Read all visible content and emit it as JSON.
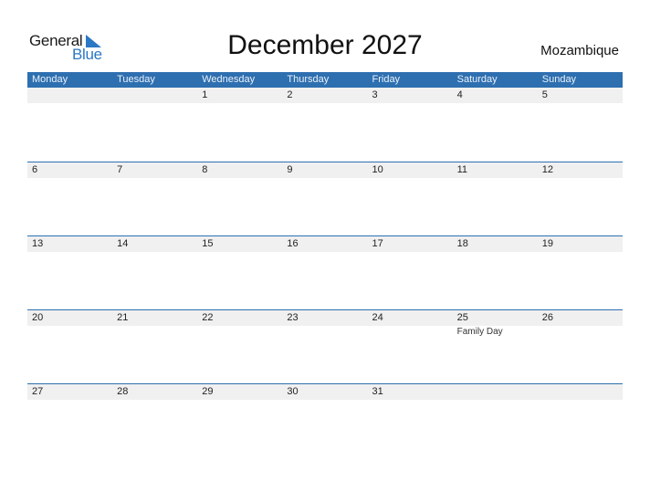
{
  "logo": {
    "general": "General",
    "blue": "Blue",
    "accent": "#2b78c5"
  },
  "title": "December 2027",
  "country": "Mozambique",
  "header_color": "#2e6fb0",
  "weekdays": [
    "Monday",
    "Tuesday",
    "Wednesday",
    "Thursday",
    "Friday",
    "Saturday",
    "Sunday"
  ],
  "weeks": [
    {
      "days": [
        "",
        "",
        "1",
        "2",
        "3",
        "4",
        "5"
      ],
      "events": [
        "",
        "",
        "",
        "",
        "",
        "",
        ""
      ]
    },
    {
      "days": [
        "6",
        "7",
        "8",
        "9",
        "10",
        "11",
        "12"
      ],
      "events": [
        "",
        "",
        "",
        "",
        "",
        "",
        ""
      ]
    },
    {
      "days": [
        "13",
        "14",
        "15",
        "16",
        "17",
        "18",
        "19"
      ],
      "events": [
        "",
        "",
        "",
        "",
        "",
        "",
        ""
      ]
    },
    {
      "days": [
        "20",
        "21",
        "22",
        "23",
        "24",
        "25",
        "26"
      ],
      "events": [
        "",
        "",
        "",
        "",
        "",
        "Family Day",
        ""
      ]
    },
    {
      "days": [
        "27",
        "28",
        "29",
        "30",
        "31",
        "",
        ""
      ],
      "events": [
        "",
        "",
        "",
        "",
        "",
        "",
        ""
      ]
    }
  ]
}
